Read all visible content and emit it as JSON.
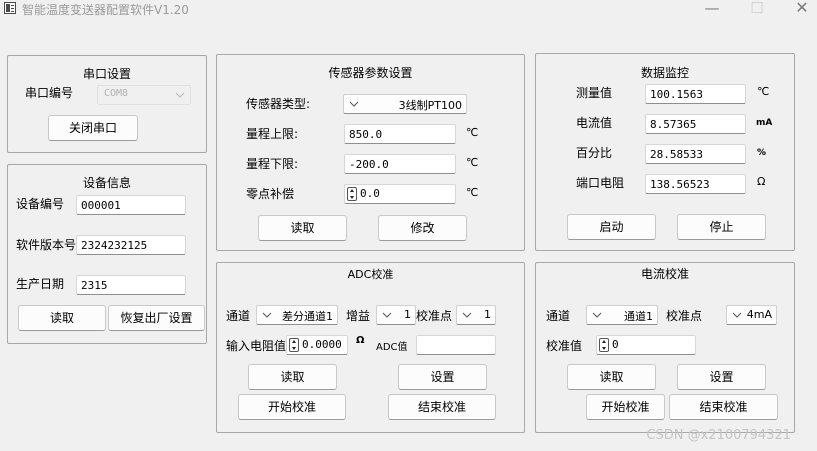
{
  "window": {
    "title": "智能温度变送器配置软件V1.20",
    "minimize_glyph": "—",
    "maximize_glyph": "☐",
    "close_glyph": "✕"
  },
  "serial": {
    "title": "串口设置",
    "port_label": "串口编号",
    "port_value": "COM8",
    "close_button": "关闭串口"
  },
  "device": {
    "title": "设备信息",
    "id_label": "设备编号",
    "id_value": "000001",
    "version_label": "软件版本号",
    "version_value": "2324232125",
    "date_label": "生产日期",
    "date_value": "2315",
    "read_button": "读取",
    "reset_button": "恢复出厂设置"
  },
  "sensor": {
    "title": "传感器参数设置",
    "type_label": "传感器类型:",
    "type_value": "3线制PT100",
    "upper_label": "量程上限:",
    "upper_value": "850.0",
    "lower_label": "量程下限:",
    "lower_value": "-200.0",
    "zero_label": "零点补偿",
    "zero_value": "0.0",
    "unit": "℃",
    "read_button": "读取",
    "modify_button": "修改"
  },
  "monitor": {
    "title": "数据监控",
    "measure_label": "测量值",
    "measure_value": "100.1563",
    "measure_unit": "℃",
    "current_label": "电流值",
    "current_value": "8.57365",
    "current_unit": "mA",
    "percent_label": "百分比",
    "percent_value": "28.58533",
    "percent_unit": "%",
    "resistance_label": "端口电阻",
    "resistance_value": "138.56523",
    "resistance_unit": "Ω",
    "start_button": "启动",
    "stop_button": "停止"
  },
  "adc": {
    "title": "ADC校准",
    "channel_label": "通道",
    "channel_value": "差分通道1",
    "gain_label": "增益",
    "gain_value": "1",
    "point_label": "校准点",
    "point_value": "1",
    "input_res_label": "输入电阻值",
    "input_res_value": "0.0000",
    "omega": "Ω",
    "adc_value_label": "ADC值",
    "adc_value": "",
    "read_button": "读取",
    "set_button": "设置",
    "start_button": "开始校准",
    "end_button": "结束校准"
  },
  "current_cal": {
    "title": "电流校准",
    "channel_label": "通道",
    "channel_value": "通道1",
    "point_label": "校准点",
    "point_value": "4mA",
    "cal_value_label": "校准值",
    "cal_value": "0",
    "read_button": "读取",
    "set_button": "设置",
    "start_button": "开始校准",
    "end_button": "结束校准"
  },
  "watermark": "CSDN @x2100794321"
}
